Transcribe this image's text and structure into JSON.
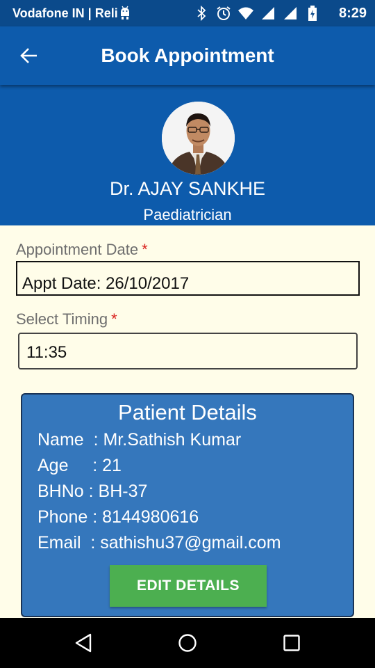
{
  "status_bar": {
    "carrier": "Vodafone IN | Reli",
    "time": "8:29",
    "icons": [
      "android-icon",
      "bluetooth-icon",
      "alarm-icon",
      "wifi-icon",
      "signal-icon",
      "signal-icon",
      "battery-icon"
    ]
  },
  "app_bar": {
    "title": "Book Appointment",
    "back_icon": "arrow-left-icon",
    "color": "#0D5BAC"
  },
  "doctor": {
    "name": "Dr. AJAY SANKHE",
    "specialty": "Paediatrician"
  },
  "form": {
    "date_label": "Appointment Date",
    "date_value": "Appt Date: 26/10/2017",
    "timing_label": "Select Timing",
    "timing_value": "11:35",
    "required_mark": "*",
    "required_color": "#D9211D"
  },
  "patient": {
    "title": "Patient Details",
    "fields": [
      {
        "key": "Name  ",
        "value": ": Mr.Sathish Kumar"
      },
      {
        "key": "Age    ",
        "value": " : 21"
      },
      {
        "key": "BHNo ",
        "value": ": BH-37"
      },
      {
        "key": "Phone ",
        "value": ": 8144980616"
      },
      {
        "key": "Email  ",
        "value": ": sathishu37@gmail.com"
      }
    ],
    "edit_button": "EDIT DETAILS",
    "card_color": "#3577BC",
    "button_color": "#4CAF50"
  },
  "nav_bar": {
    "icons": [
      "back-triangle-icon",
      "home-circle-icon",
      "recents-square-icon"
    ]
  }
}
